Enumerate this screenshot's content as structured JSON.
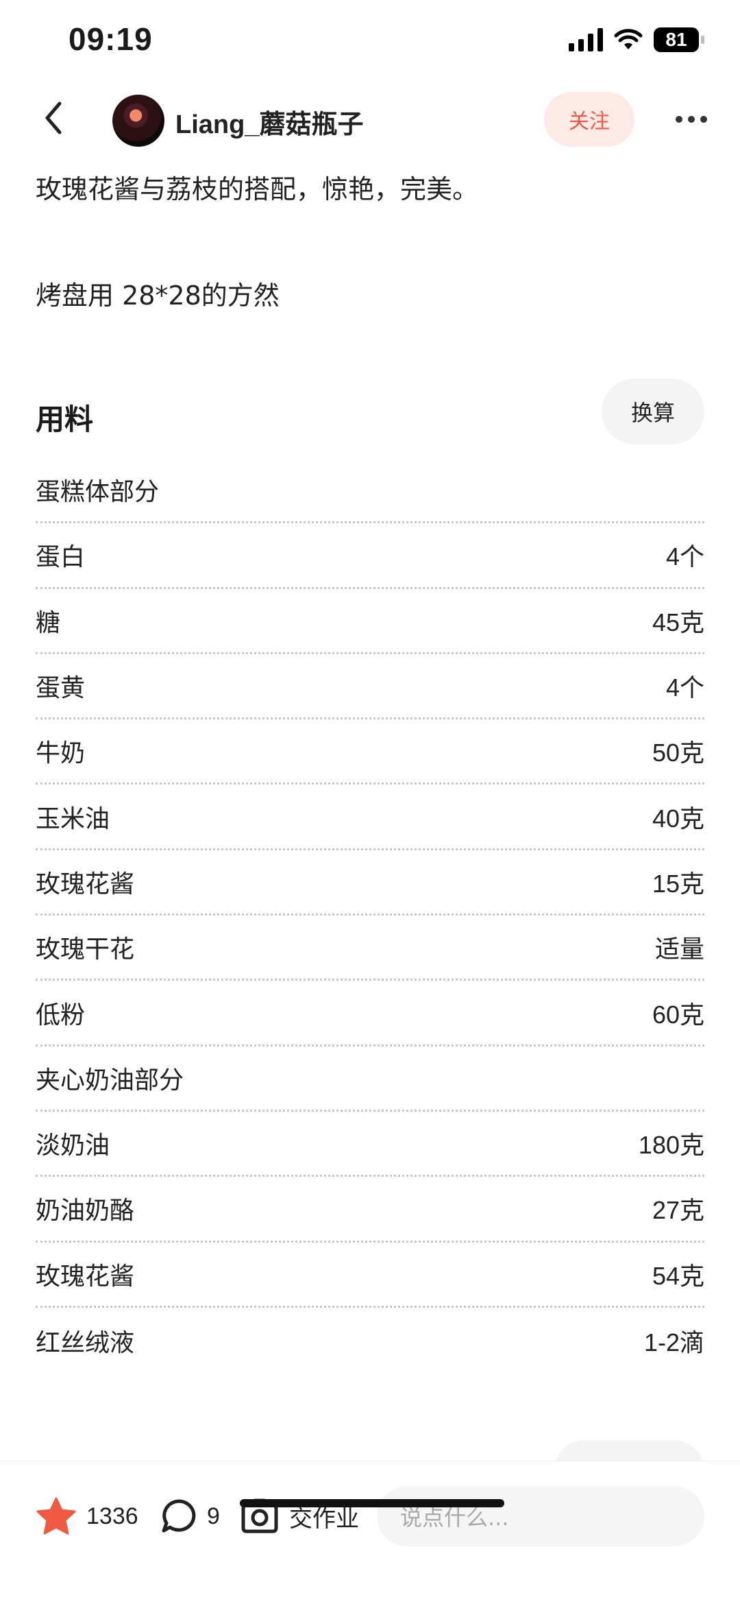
{
  "status_bar": {
    "time": "09:19",
    "battery": "81"
  },
  "header": {
    "username": "Liang_蘑菇瓶子",
    "follow_label": "关注"
  },
  "description": {
    "line1": "玫瑰花酱与荔枝的搭配，惊艳，完美。",
    "line2": "烤盘用 28*28的方然"
  },
  "ingredients": {
    "title": "用料",
    "convert_label": "换算",
    "items": [
      {
        "name": "蛋糕体部分",
        "qty": ""
      },
      {
        "name": "蛋白",
        "qty": "4个"
      },
      {
        "name": "糖",
        "qty": "45克"
      },
      {
        "name": "蛋黄",
        "qty": "4个"
      },
      {
        "name": "牛奶",
        "qty": "50克"
      },
      {
        "name": "玉米油",
        "qty": "40克"
      },
      {
        "name": "玫瑰花酱",
        "qty": "15克"
      },
      {
        "name": "玫瑰干花",
        "qty": "适量"
      },
      {
        "name": "低粉",
        "qty": "60克"
      },
      {
        "name": "夹心奶油部分",
        "qty": ""
      },
      {
        "name": "淡奶油",
        "qty": "180克"
      },
      {
        "name": "奶油奶酪",
        "qty": "27克"
      },
      {
        "name": "玫瑰花酱",
        "qty": "54克"
      },
      {
        "name": "红丝绒液",
        "qty": "1-2滴"
      }
    ]
  },
  "bottom_bar": {
    "like_count": "1336",
    "comment_count": "9",
    "homework_label": "交作业",
    "comment_placeholder": "说点什么..."
  },
  "colors": {
    "accent": "#ee5b42",
    "follow_bg": "#fdeae6"
  }
}
